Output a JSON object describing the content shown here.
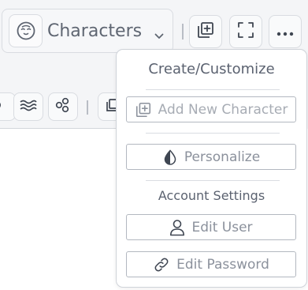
{
  "toolbar": {
    "characters_label": "Characters",
    "icons": [
      "face-icon",
      "chevron-down-icon",
      "add-box-icon",
      "fullscreen-icon",
      "more-icon"
    ]
  },
  "row2": {
    "icons": [
      "partial-icon",
      "waves-icon",
      "nodes-icon",
      "add-box-icon"
    ]
  },
  "menu": {
    "create_heading": "Create/Customize",
    "add_new_character": "Add New Character",
    "personalize": "Personalize",
    "account_heading": "Account Settings",
    "edit_user": "Edit User",
    "edit_password": "Edit Password"
  },
  "colors": {
    "text": "#5f6672",
    "muted": "#8b919c",
    "border": "#d9dce1",
    "background": "#f4f5f7"
  }
}
